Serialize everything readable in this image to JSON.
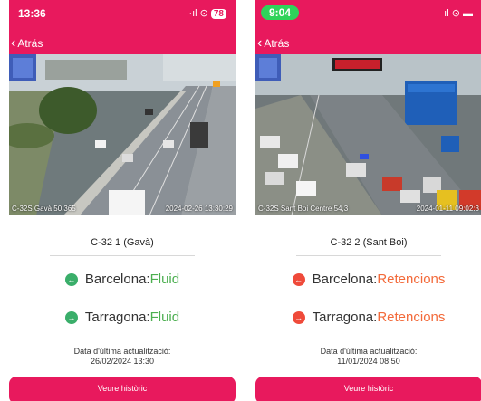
{
  "colors": {
    "accent": "#e8195d",
    "fluid": "#4caf50",
    "retencions": "#f36a3a"
  },
  "left": {
    "status_time": "13:36",
    "status_icons": "·ıl ⊙",
    "battery": "78",
    "back_label": "Atrás",
    "camera_location": "C-32S Gavà 50,365",
    "camera_timestamp": "2024-02-26 13:30:29",
    "road_title": "C-32 1 (Gavà)",
    "dir1_name": "Barcelona: ",
    "dir1_status": "Fluid",
    "dir2_name": "Tarragona: ",
    "dir2_status": "Fluid",
    "updated_label": "Data d'última actualització:",
    "updated_date": "26/02/2024 13:30",
    "history_button": "Veure històric"
  },
  "right": {
    "status_time": "9:04",
    "status_icons": "ıl ⊙ ▬",
    "back_label": "Atrás",
    "camera_location": "C-32S Sant Boi Centre 54,3",
    "camera_timestamp": "2024-01-11 09:02:3",
    "road_title": "C-32 2 (Sant Boi)",
    "dir1_name": "Barcelona: ",
    "dir1_status": "Retencions",
    "dir2_name": "Tarragona: ",
    "dir2_status": "Retencions",
    "updated_label": "Data d'última actualització:",
    "updated_date": "11/01/2024 08:50",
    "history_button": "Veure històric"
  }
}
